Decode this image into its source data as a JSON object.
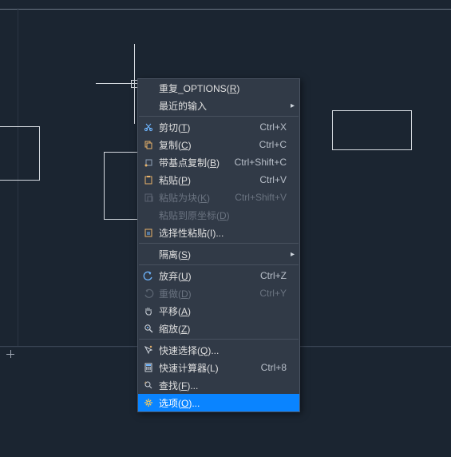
{
  "menu": {
    "repeat": {
      "label": "重复_OPTIONS(",
      "key": "R",
      "tail": ")"
    },
    "recent": {
      "label": "最近的输入"
    },
    "cut": {
      "label": "剪切(",
      "key": "T",
      "tail": ")",
      "shortcut": "Ctrl+X"
    },
    "copy": {
      "label": "复制(",
      "key": "C",
      "tail": ")",
      "shortcut": "Ctrl+C"
    },
    "copybase": {
      "label": "带基点复制(",
      "key": "B",
      "tail": ")",
      "shortcut": "Ctrl+Shift+C"
    },
    "paste": {
      "label": "粘贴(",
      "key": "P",
      "tail": ")",
      "shortcut": "Ctrl+V"
    },
    "pasteblock": {
      "label": "粘贴为块(",
      "key": "K",
      "tail": ")",
      "shortcut": "Ctrl+Shift+V"
    },
    "pasteorig": {
      "label": "粘贴到原坐标(",
      "key": "D",
      "tail": ")"
    },
    "pastespecial": {
      "label": "选择性粘贴(I)..."
    },
    "isolate": {
      "label": "隔离(",
      "key": "S",
      "tail": ")"
    },
    "undo": {
      "label": "放弃(",
      "key": "U",
      "tail": ")",
      "shortcut": "Ctrl+Z"
    },
    "redo": {
      "label": "重做(",
      "key": "D",
      "tail": ")",
      "shortcut": "Ctrl+Y"
    },
    "pan": {
      "label": "平移(",
      "key": "A",
      "tail": ")"
    },
    "zoom": {
      "label": "缩放(",
      "key": "Z",
      "tail": ")"
    },
    "quickselect": {
      "label": "快速选择(",
      "key": "Q",
      "tail": ")..."
    },
    "quickcalc": {
      "label": "快速计算器(L)",
      "shortcut": "Ctrl+8"
    },
    "find": {
      "label": "查找(",
      "key": "F",
      "tail": ")..."
    },
    "options": {
      "label": "选项(",
      "key": "O",
      "tail": ")..."
    }
  }
}
